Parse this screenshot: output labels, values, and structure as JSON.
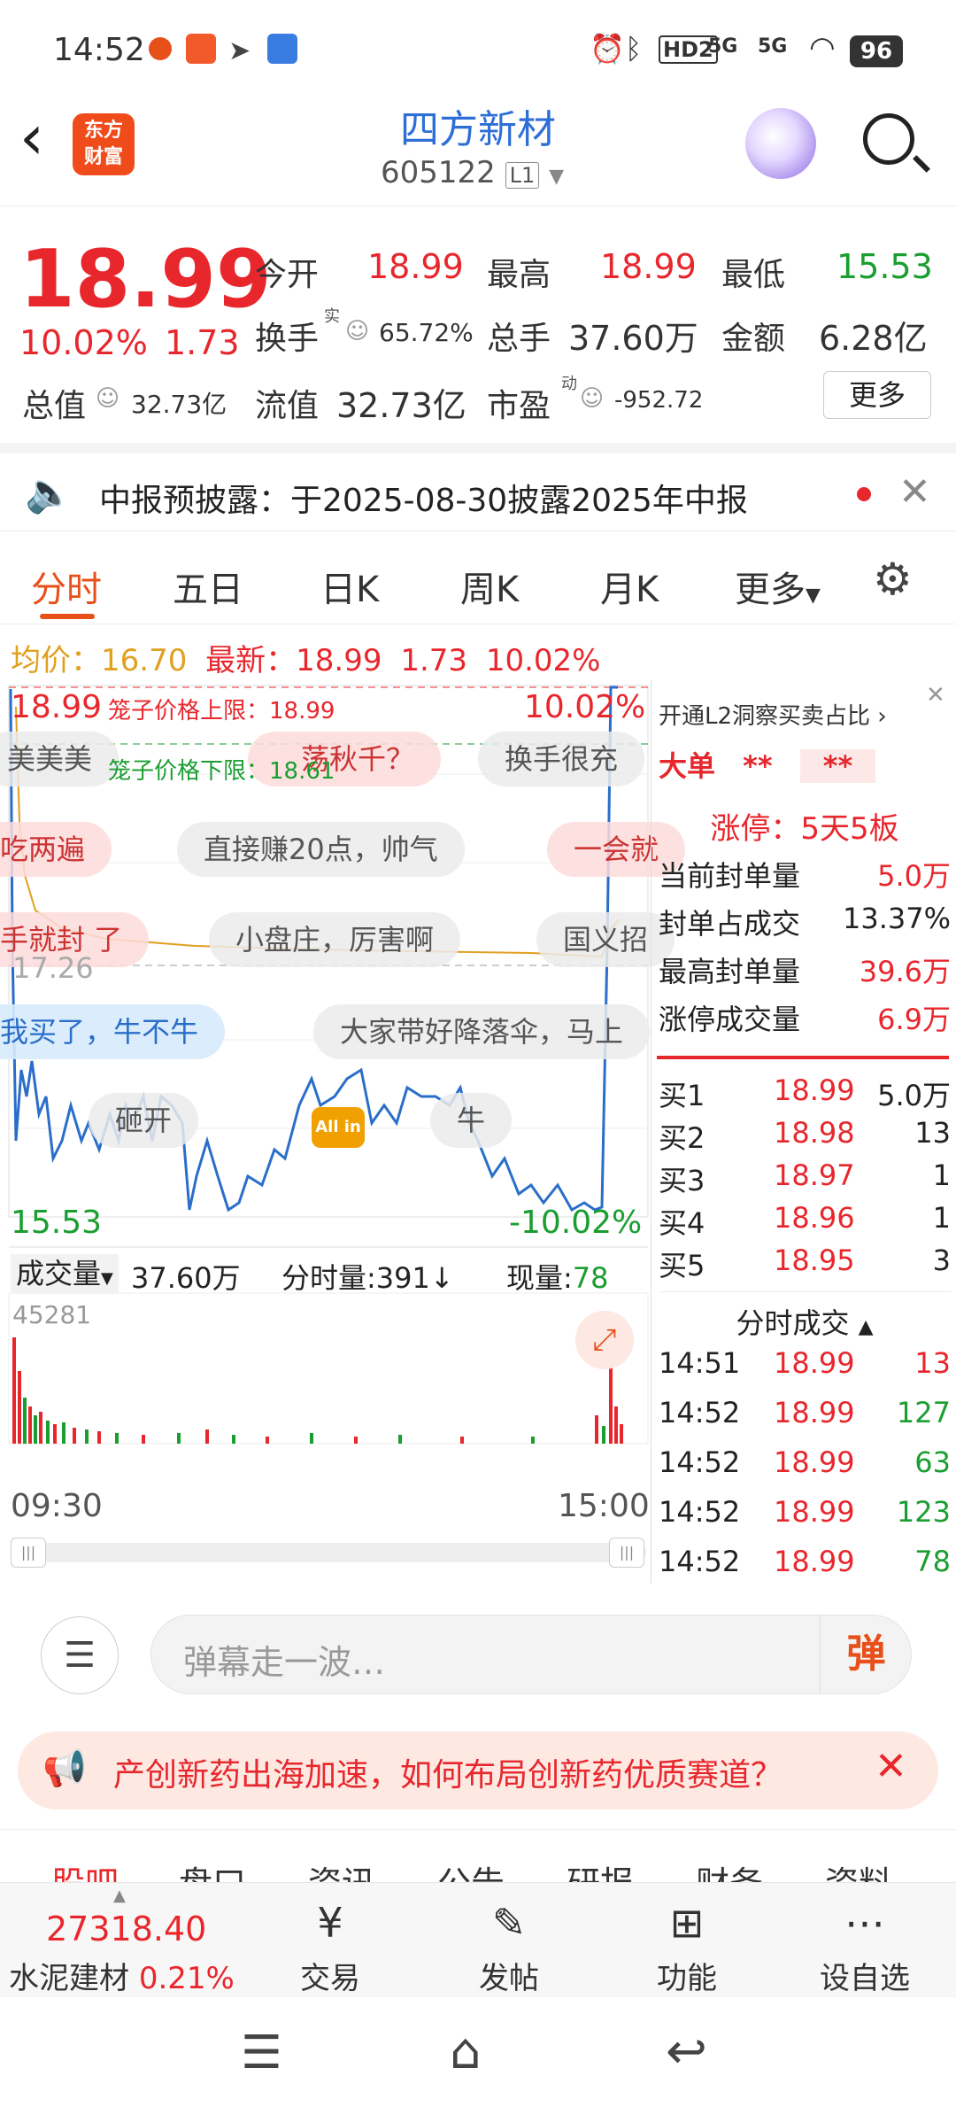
{
  "status_bar": {
    "time": "14:52",
    "battery": "96",
    "network1": "5G",
    "network2": "5G",
    "hd": "HD2"
  },
  "header": {
    "logo_line1": "东方",
    "logo_line2": "财富",
    "stock_name": "四方新材",
    "stock_code": "605122",
    "level_badge": "L1"
  },
  "quote": {
    "price": "18.99",
    "change_pct": "10.02%",
    "change": "1.73",
    "open_label": "今开",
    "open": "18.99",
    "high_label": "最高",
    "high": "18.99",
    "low_label": "最低",
    "low": "15.53",
    "turnover_label": "换手",
    "turnover_sup": "实",
    "turnover": "65.72%",
    "volume_label": "总手",
    "volume": "37.60万",
    "amount_label": "金额",
    "amount": "6.28亿",
    "mktcap_label": "总值",
    "mktcap": "32.73亿",
    "float_label": "流值",
    "float": "32.73亿",
    "pe_label": "市盈",
    "pe_sup": "动",
    "pe": "-952.72",
    "more_button": "更多"
  },
  "notice": {
    "text": "中报预披露：于2025-08-30披露2025年中报"
  },
  "tabs": [
    "分时",
    "五日",
    "日K",
    "周K",
    "月K",
    "更多"
  ],
  "avg_line": {
    "avg_label": "均价：",
    "avg": "16.70",
    "latest_label": "最新：",
    "latest": "18.99",
    "chg": "1.73",
    "pct": "10.02%"
  },
  "chart": {
    "top_price": "18.99",
    "limit_up_text": "笼子价格上限：18.99",
    "top_pct": "10.02%",
    "limit_down_text": "笼子价格下限：18.61",
    "mid_price": "17.26",
    "bottom_price": "15.53",
    "bottom_pct": "-10.02%",
    "allin_badge": "All in",
    "barrage": [
      "美美美",
      "荡秋千？",
      "换手很充",
      "吃两遍",
      "直接赚20点，帅气",
      "一会就",
      "手就封 了",
      "小盘庄，厉害啊",
      "国义招",
      "我买了，牛不牛",
      "大家带好降落伞，马上",
      "砸开",
      "牛"
    ],
    "volume_label": "成交量",
    "volume_value": "37.60万",
    "tick_volume_label": "分时量:391↓",
    "current_volume_label": "现量:",
    "current_volume": "78",
    "volume_max": "45281",
    "time_start": "09:30",
    "time_end": "15:00"
  },
  "panel": {
    "title": "开通L2洞察买卖占比",
    "big_order_label": "大单",
    "big_order_val1": "**",
    "big_order_val2": "**",
    "limit_status": "涨停：5天5板",
    "seal_qty_label": "当前封单量",
    "seal_qty": "5.0万",
    "seal_ratio_label": "封单占成交",
    "seal_ratio": "13.37%",
    "max_seal_label": "最高封单量",
    "max_seal": "39.6万",
    "limit_vol_label": "涨停成交量",
    "limit_vol": "6.9万",
    "bids": [
      {
        "label": "买1",
        "price": "18.99",
        "qty": "5.0万"
      },
      {
        "label": "买2",
        "price": "18.98",
        "qty": "13"
      },
      {
        "label": "买3",
        "price": "18.97",
        "qty": "1"
      },
      {
        "label": "买4",
        "price": "18.96",
        "qty": "1"
      },
      {
        "label": "买5",
        "price": "18.95",
        "qty": "3"
      }
    ],
    "trades_title": "分时成交",
    "trades": [
      {
        "time": "14:51",
        "price": "18.99",
        "qty": "13"
      },
      {
        "time": "14:52",
        "price": "18.99",
        "qty": "127"
      },
      {
        "time": "14:52",
        "price": "18.99",
        "qty": "63"
      },
      {
        "time": "14:52",
        "price": "18.99",
        "qty": "123"
      },
      {
        "time": "14:52",
        "price": "18.99",
        "qty": "78"
      }
    ]
  },
  "input_bar": {
    "placeholder": "弹幕走一波…",
    "danmu_button": "弹"
  },
  "ad": {
    "text": "产创新药出海加速，如何布局创新药优质赛道？"
  },
  "sub_tabs": [
    "股吧",
    "盘口",
    "资讯",
    "公告",
    "研报",
    "财务",
    "资料"
  ],
  "bottom_nav": {
    "index_value": "27318.40",
    "index_name": "水泥建材",
    "index_pct": "0.21%",
    "items": [
      "交易",
      "发帖",
      "功能",
      "设自选"
    ]
  }
}
